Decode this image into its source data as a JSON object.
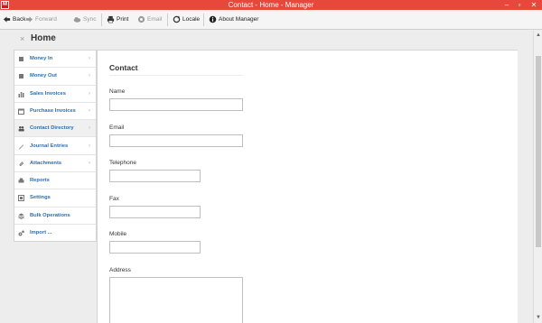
{
  "window": {
    "title": "Contact - Home - Manager",
    "app_icon": "M",
    "minimize": "–",
    "maximize": "▫",
    "close": "✕"
  },
  "toolbar": {
    "back": "Back",
    "forward": "Forward",
    "sync": "Sync",
    "print": "Print",
    "email": "Email",
    "locale": "Locale",
    "about": "About Manager"
  },
  "header": {
    "close_glyph": "×",
    "title": "Home"
  },
  "sidebar": {
    "items": [
      {
        "label": "Money In",
        "icon": "square-icon"
      },
      {
        "label": "Money Out",
        "icon": "square-icon"
      },
      {
        "label": "Sales Invoices",
        "icon": "bar-chart-icon"
      },
      {
        "label": "Purchase Invoices",
        "icon": "calendar-icon"
      },
      {
        "label": "Contact Directory",
        "icon": "people-icon"
      },
      {
        "label": "Journal Entries",
        "icon": "pen-icon"
      },
      {
        "label": "Attachments",
        "icon": "paperclip-icon"
      },
      {
        "label": "Reports",
        "icon": "printer-icon"
      },
      {
        "label": "Settings",
        "icon": "settings-icon"
      },
      {
        "label": "Bulk Operations",
        "icon": "stack-icon"
      },
      {
        "label": "Import ...",
        "icon": "gears-icon"
      }
    ],
    "chevron": "›"
  },
  "form": {
    "title": "Contact",
    "fields": {
      "name": {
        "label": "Name",
        "value": ""
      },
      "email": {
        "label": "Email",
        "value": ""
      },
      "telephone": {
        "label": "Telephone",
        "value": ""
      },
      "fax": {
        "label": "Fax",
        "value": ""
      },
      "mobile": {
        "label": "Mobile",
        "value": ""
      },
      "address": {
        "label": "Address",
        "value": ""
      }
    }
  },
  "colors": {
    "titlebar": "#e8473c",
    "link": "#2a6fb0"
  }
}
